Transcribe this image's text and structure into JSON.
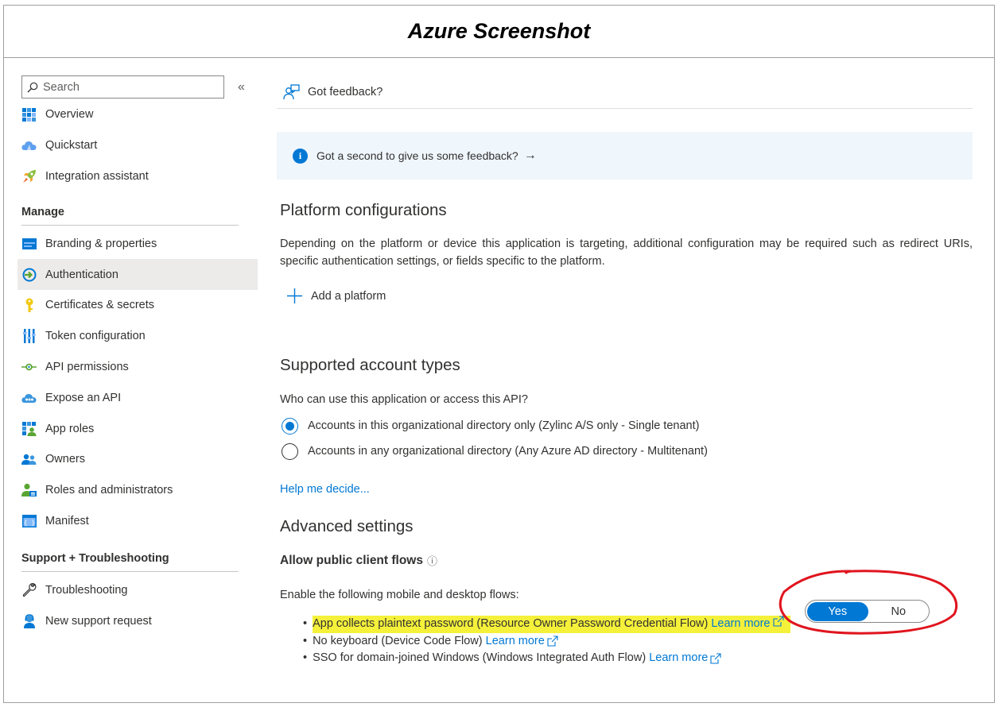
{
  "header": {
    "title": "Azure Screenshot"
  },
  "sidebar": {
    "search_placeholder": "Search",
    "collapse_glyph": "«",
    "top_items": [
      {
        "label": "Overview",
        "icon": "grid-icon"
      },
      {
        "label": "Quickstart",
        "icon": "cloud-icon"
      },
      {
        "label": "Integration assistant",
        "icon": "rocket-icon"
      }
    ],
    "manage_heading": "Manage",
    "manage_items": [
      {
        "label": "Branding & properties",
        "icon": "branding-icon"
      },
      {
        "label": "Authentication",
        "icon": "authentication-icon",
        "active": true
      },
      {
        "label": "Certificates & secrets",
        "icon": "key-icon"
      },
      {
        "label": "Token configuration",
        "icon": "token-icon"
      },
      {
        "label": "API permissions",
        "icon": "api-permissions-icon"
      },
      {
        "label": "Expose an API",
        "icon": "cloud-api-icon"
      },
      {
        "label": "App roles",
        "icon": "app-roles-icon"
      },
      {
        "label": "Owners",
        "icon": "owners-icon"
      },
      {
        "label": "Roles and administrators",
        "icon": "roles-icon"
      },
      {
        "label": "Manifest",
        "icon": "manifest-icon"
      }
    ],
    "support_heading": "Support + Troubleshooting",
    "support_items": [
      {
        "label": "Troubleshooting",
        "icon": "wrench-icon"
      },
      {
        "label": "New support request",
        "icon": "support-person-icon"
      }
    ]
  },
  "main": {
    "feedback_label": "Got feedback?",
    "banner_text": "Got a second to give us some feedback?",
    "banner_arrow": "→",
    "platform": {
      "heading": "Platform configurations",
      "description": "Depending on the platform or device this application is targeting, additional configuration may be required such as redirect URIs, specific authentication settings, or fields specific to the platform.",
      "add_label": "Add a platform"
    },
    "accounts": {
      "heading": "Supported account types",
      "question": "Who can use this application or access this API?",
      "options": [
        {
          "label": "Accounts in this organizational directory only (Zylinc A/S only - Single tenant)",
          "selected": true
        },
        {
          "label": "Accounts in any organizational directory (Any Azure AD directory - Multitenant)",
          "selected": false
        }
      ],
      "help_link": "Help me decide..."
    },
    "advanced": {
      "heading": "Advanced settings",
      "public_flows_label": "Allow public client flows",
      "info_glyph": "ⓘ",
      "enable_label": "Enable the following mobile and desktop flows:",
      "toggle": {
        "yes": "Yes",
        "no": "No",
        "value": "Yes"
      },
      "bullets": [
        {
          "text": "App collects plaintext password (Resource Owner Password Credential Flow)",
          "link": "Learn more",
          "highlighted": true
        },
        {
          "text": "No keyboard (Device Code Flow)",
          "link": "Learn more",
          "highlighted": false
        },
        {
          "text": "SSO for domain-joined Windows (Windows Integrated Auth Flow)",
          "link": "Learn more",
          "highlighted": false
        }
      ]
    }
  },
  "colors": {
    "accent": "#0078d4",
    "highlight": "#f5f13a",
    "annotation": "#e0141e",
    "active_bg": "#edebe9",
    "banner_bg": "#eff6fc"
  }
}
